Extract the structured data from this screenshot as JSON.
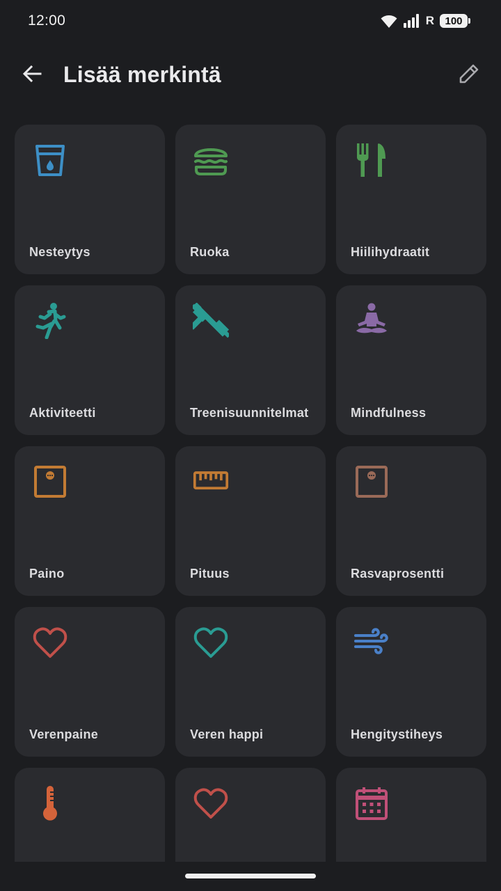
{
  "status_bar": {
    "time": "12:00",
    "battery": "100",
    "network_label": "R"
  },
  "header": {
    "title": "Lisää merkintä"
  },
  "tiles": [
    {
      "label": "Nesteytys",
      "icon": "water-glass-icon",
      "color": "#3d8fc6"
    },
    {
      "label": "Ruoka",
      "icon": "burger-icon",
      "color": "#4f9a52"
    },
    {
      "label": "Hiilihydraatit",
      "icon": "fork-knife-icon",
      "color": "#4f9a52"
    },
    {
      "label": "Aktiviteetti",
      "icon": "running-icon",
      "color": "#2a9c93"
    },
    {
      "label": "Treenisuunnitelmat",
      "icon": "dumbbell-icon",
      "color": "#2a9c93"
    },
    {
      "label": "Mindfulness",
      "icon": "meditation-icon",
      "color": "#8a6aa6"
    },
    {
      "label": "Paino",
      "icon": "scale-icon",
      "color": "#c27b34"
    },
    {
      "label": "Pituus",
      "icon": "ruler-icon",
      "color": "#c27b34"
    },
    {
      "label": "Rasvaprosentti",
      "icon": "body-fat-scale-icon",
      "color": "#9a6a58"
    },
    {
      "label": "Verenpaine",
      "icon": "heart-icon",
      "color": "#c0504a"
    },
    {
      "label": "Veren happi",
      "icon": "heart-icon",
      "color": "#2a9c93"
    },
    {
      "label": "Hengitystiheys",
      "icon": "wind-icon",
      "color": "#4a80c8"
    },
    {
      "label": "",
      "icon": "thermometer-icon",
      "color": "#d4633a"
    },
    {
      "label": "",
      "icon": "heart-icon",
      "color": "#c0504a"
    },
    {
      "label": "",
      "icon": "calendar-icon",
      "color": "#c05078"
    }
  ]
}
